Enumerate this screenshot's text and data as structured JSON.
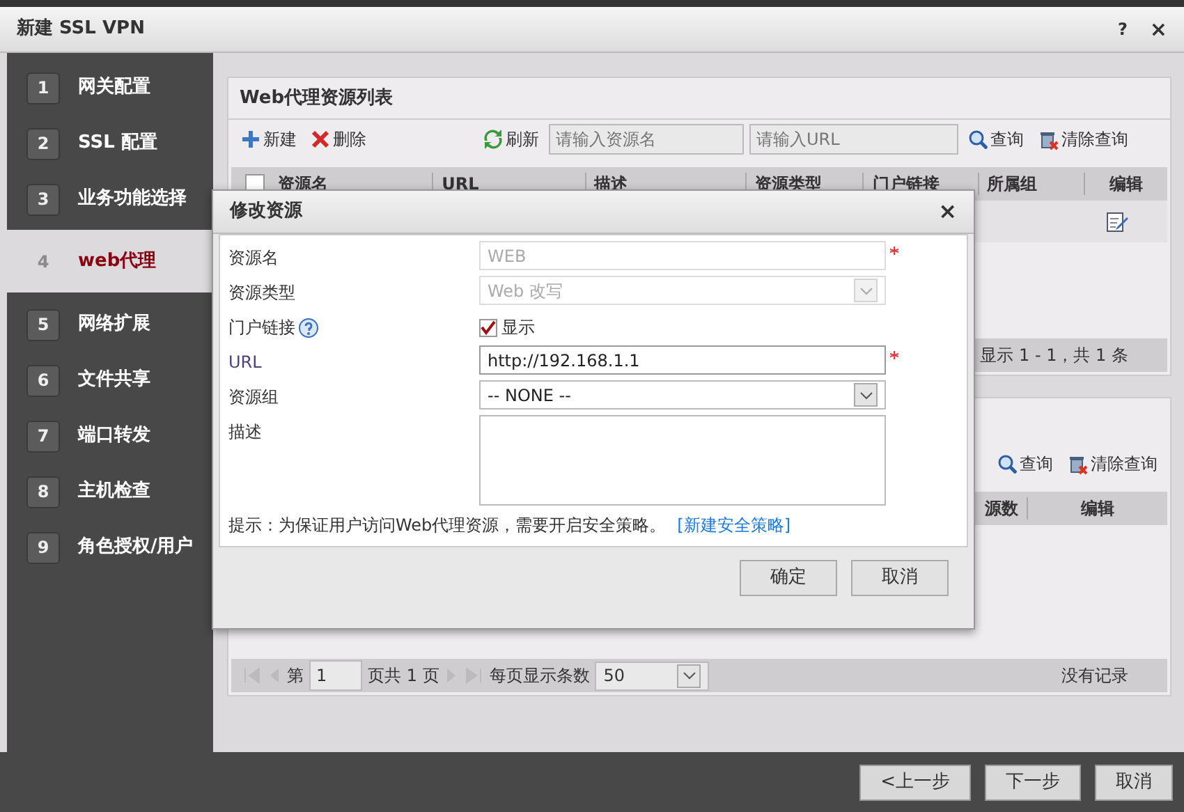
{
  "window": {
    "title": "新建 SSL VPN",
    "help": "?",
    "close": "×"
  },
  "sidebar": {
    "items": [
      {
        "number": "1",
        "label": "网关配置",
        "selected": false
      },
      {
        "number": "2",
        "label": "SSL 配置",
        "selected": false
      },
      {
        "number": "3",
        "label": "业务功能选择",
        "selected": false
      },
      {
        "number": "4",
        "label": "web代理",
        "selected": true
      },
      {
        "number": "5",
        "label": "网络扩展",
        "selected": false
      },
      {
        "number": "6",
        "label": "文件共享",
        "selected": false
      },
      {
        "number": "7",
        "label": "端口转发",
        "selected": false
      },
      {
        "number": "8",
        "label": "主机检查",
        "selected": false
      },
      {
        "number": "9",
        "label": "角色授权/用户",
        "selected": false
      }
    ]
  },
  "resource_list": {
    "title": "Web代理资源列表",
    "toolbar": {
      "new": "新建",
      "delete": "删除",
      "refresh": "刷新",
      "name_placeholder": "请输入资源名",
      "url_placeholder": "请输入URL",
      "query": "查询",
      "clear": "清除查询"
    },
    "select_all_checked": false,
    "columns": [
      "资源名",
      "URL",
      "描述",
      "资源类型",
      "门户链接",
      "所属组",
      "编辑"
    ],
    "pager_info": "显示 1 - 1，共 1 条"
  },
  "lower_panel": {
    "toolbar": {
      "query": "查询",
      "clear": "清除查询"
    },
    "columns": [
      "源数",
      "编辑"
    ],
    "pager": {
      "page_prefix": "第",
      "page": "1",
      "page_suffix": "页共 1 页",
      "per_page_label": "每页显示条数",
      "per_page": "50",
      "status": "没有记录"
    }
  },
  "dialog": {
    "title": "修改资源",
    "close": "×",
    "fields": [
      {
        "kind": "text",
        "label": "资源名",
        "value": "WEB",
        "disabled": true,
        "required": true
      },
      {
        "kind": "select",
        "label": "资源类型",
        "value": "Web 改写",
        "disabled": true
      },
      {
        "kind": "checkbox",
        "label": "门户链接",
        "option": "显示",
        "checked": true
      },
      {
        "kind": "text",
        "label": "URL",
        "value": "http://192.168.1.1",
        "disabled": false,
        "required": true
      },
      {
        "kind": "select",
        "label": "资源组",
        "value": "-- NONE --",
        "disabled": false
      },
      {
        "kind": "textarea",
        "label": "描述"
      }
    ],
    "hint": "提示：为保证用户访问Web代理资源，需要开启安全策略。",
    "hint_link": "[新建安全策略]",
    "buttons": [
      "确定",
      "取消"
    ]
  },
  "footer_buttons": [
    "<上一步",
    "下一步",
    "取消"
  ]
}
